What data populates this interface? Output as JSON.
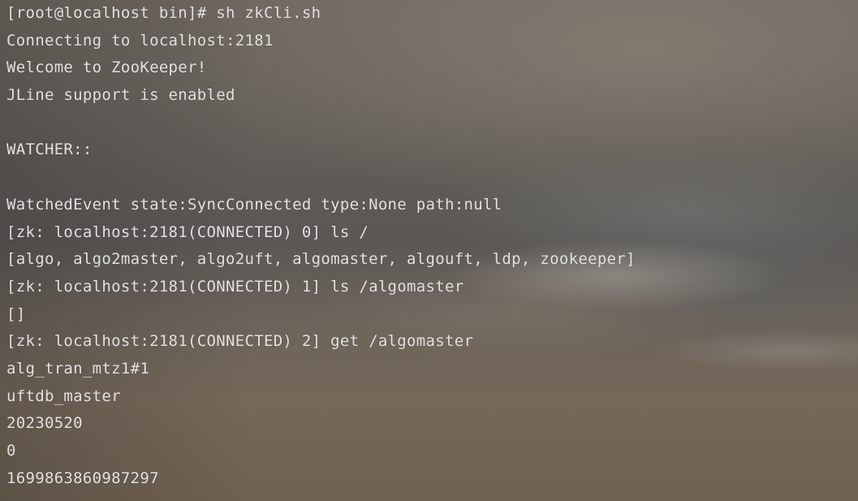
{
  "terminal": {
    "lines": [
      "[root@localhost bin]# sh zkCli.sh",
      "Connecting to localhost:2181",
      "Welcome to ZooKeeper!",
      "JLine support is enabled",
      "",
      "WATCHER::",
      "",
      "WatchedEvent state:SyncConnected type:None path:null",
      "[zk: localhost:2181(CONNECTED) 0] ls /",
      "[algo, algo2master, algo2uft, algomaster, algouft, ldp, zookeeper]",
      "[zk: localhost:2181(CONNECTED) 1] ls /algomaster",
      "[]",
      "[zk: localhost:2181(CONNECTED) 2] get /algomaster",
      "alg_tran_mtz1#1",
      "uftdb_master",
      "20230520",
      "0",
      "1699863860987297"
    ]
  },
  "colors": {
    "text": "#e2e2e2",
    "background_top": "#6e6760",
    "background_mid": "#5a5754",
    "background_bottom": "#6f6356"
  }
}
